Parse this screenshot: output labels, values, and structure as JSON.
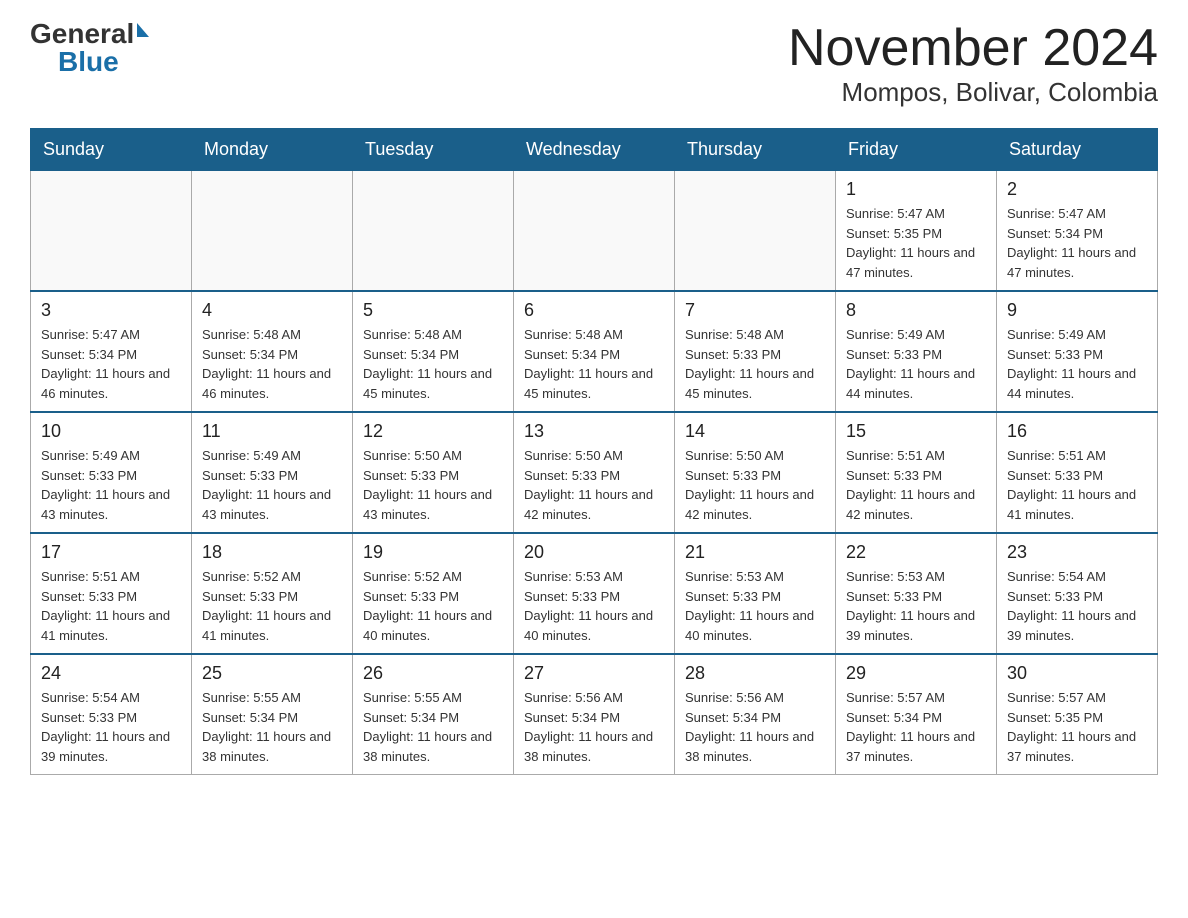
{
  "header": {
    "logo_general": "General",
    "logo_blue": "Blue",
    "month_title": "November 2024",
    "location": "Mompos, Bolivar, Colombia"
  },
  "days_of_week": [
    "Sunday",
    "Monday",
    "Tuesday",
    "Wednesday",
    "Thursday",
    "Friday",
    "Saturday"
  ],
  "weeks": [
    [
      {
        "day": "",
        "info": ""
      },
      {
        "day": "",
        "info": ""
      },
      {
        "day": "",
        "info": ""
      },
      {
        "day": "",
        "info": ""
      },
      {
        "day": "",
        "info": ""
      },
      {
        "day": "1",
        "info": "Sunrise: 5:47 AM\nSunset: 5:35 PM\nDaylight: 11 hours and 47 minutes."
      },
      {
        "day": "2",
        "info": "Sunrise: 5:47 AM\nSunset: 5:34 PM\nDaylight: 11 hours and 47 minutes."
      }
    ],
    [
      {
        "day": "3",
        "info": "Sunrise: 5:47 AM\nSunset: 5:34 PM\nDaylight: 11 hours and 46 minutes."
      },
      {
        "day": "4",
        "info": "Sunrise: 5:48 AM\nSunset: 5:34 PM\nDaylight: 11 hours and 46 minutes."
      },
      {
        "day": "5",
        "info": "Sunrise: 5:48 AM\nSunset: 5:34 PM\nDaylight: 11 hours and 45 minutes."
      },
      {
        "day": "6",
        "info": "Sunrise: 5:48 AM\nSunset: 5:34 PM\nDaylight: 11 hours and 45 minutes."
      },
      {
        "day": "7",
        "info": "Sunrise: 5:48 AM\nSunset: 5:33 PM\nDaylight: 11 hours and 45 minutes."
      },
      {
        "day": "8",
        "info": "Sunrise: 5:49 AM\nSunset: 5:33 PM\nDaylight: 11 hours and 44 minutes."
      },
      {
        "day": "9",
        "info": "Sunrise: 5:49 AM\nSunset: 5:33 PM\nDaylight: 11 hours and 44 minutes."
      }
    ],
    [
      {
        "day": "10",
        "info": "Sunrise: 5:49 AM\nSunset: 5:33 PM\nDaylight: 11 hours and 43 minutes."
      },
      {
        "day": "11",
        "info": "Sunrise: 5:49 AM\nSunset: 5:33 PM\nDaylight: 11 hours and 43 minutes."
      },
      {
        "day": "12",
        "info": "Sunrise: 5:50 AM\nSunset: 5:33 PM\nDaylight: 11 hours and 43 minutes."
      },
      {
        "day": "13",
        "info": "Sunrise: 5:50 AM\nSunset: 5:33 PM\nDaylight: 11 hours and 42 minutes."
      },
      {
        "day": "14",
        "info": "Sunrise: 5:50 AM\nSunset: 5:33 PM\nDaylight: 11 hours and 42 minutes."
      },
      {
        "day": "15",
        "info": "Sunrise: 5:51 AM\nSunset: 5:33 PM\nDaylight: 11 hours and 42 minutes."
      },
      {
        "day": "16",
        "info": "Sunrise: 5:51 AM\nSunset: 5:33 PM\nDaylight: 11 hours and 41 minutes."
      }
    ],
    [
      {
        "day": "17",
        "info": "Sunrise: 5:51 AM\nSunset: 5:33 PM\nDaylight: 11 hours and 41 minutes."
      },
      {
        "day": "18",
        "info": "Sunrise: 5:52 AM\nSunset: 5:33 PM\nDaylight: 11 hours and 41 minutes."
      },
      {
        "day": "19",
        "info": "Sunrise: 5:52 AM\nSunset: 5:33 PM\nDaylight: 11 hours and 40 minutes."
      },
      {
        "day": "20",
        "info": "Sunrise: 5:53 AM\nSunset: 5:33 PM\nDaylight: 11 hours and 40 minutes."
      },
      {
        "day": "21",
        "info": "Sunrise: 5:53 AM\nSunset: 5:33 PM\nDaylight: 11 hours and 40 minutes."
      },
      {
        "day": "22",
        "info": "Sunrise: 5:53 AM\nSunset: 5:33 PM\nDaylight: 11 hours and 39 minutes."
      },
      {
        "day": "23",
        "info": "Sunrise: 5:54 AM\nSunset: 5:33 PM\nDaylight: 11 hours and 39 minutes."
      }
    ],
    [
      {
        "day": "24",
        "info": "Sunrise: 5:54 AM\nSunset: 5:33 PM\nDaylight: 11 hours and 39 minutes."
      },
      {
        "day": "25",
        "info": "Sunrise: 5:55 AM\nSunset: 5:34 PM\nDaylight: 11 hours and 38 minutes."
      },
      {
        "day": "26",
        "info": "Sunrise: 5:55 AM\nSunset: 5:34 PM\nDaylight: 11 hours and 38 minutes."
      },
      {
        "day": "27",
        "info": "Sunrise: 5:56 AM\nSunset: 5:34 PM\nDaylight: 11 hours and 38 minutes."
      },
      {
        "day": "28",
        "info": "Sunrise: 5:56 AM\nSunset: 5:34 PM\nDaylight: 11 hours and 38 minutes."
      },
      {
        "day": "29",
        "info": "Sunrise: 5:57 AM\nSunset: 5:34 PM\nDaylight: 11 hours and 37 minutes."
      },
      {
        "day": "30",
        "info": "Sunrise: 5:57 AM\nSunset: 5:35 PM\nDaylight: 11 hours and 37 minutes."
      }
    ]
  ]
}
